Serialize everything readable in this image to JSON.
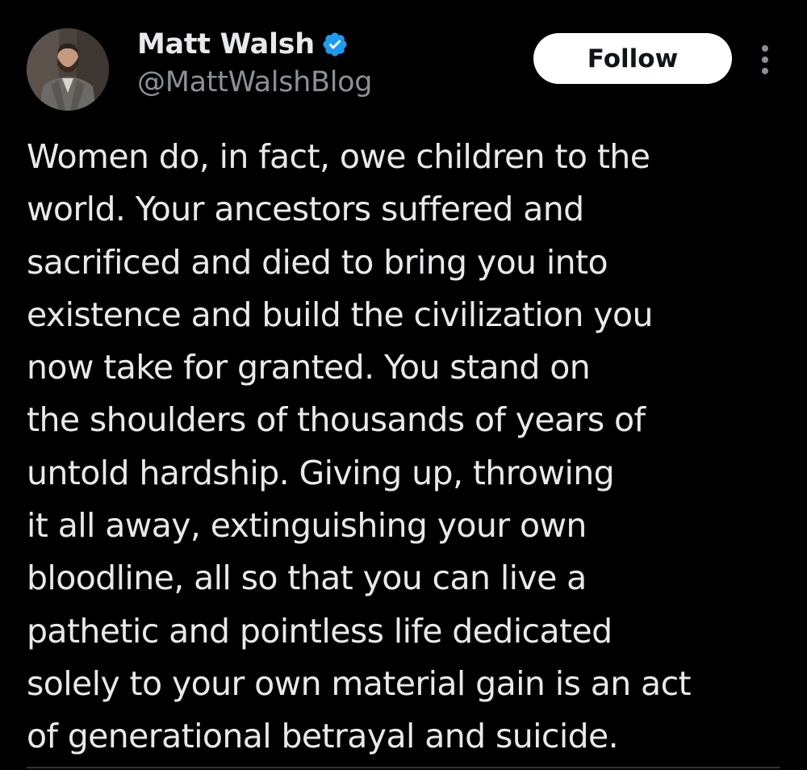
{
  "author": {
    "display_name": "Matt Walsh",
    "handle": "@MattWalshBlog",
    "verified": true,
    "avatar_icon": "profile-photo"
  },
  "actions": {
    "follow_label": "Follow",
    "more_icon": "more-vertical-icon"
  },
  "tweet": {
    "lines": [
      "Women do, in fact, owe children to the",
      "world. Your ancestors suffered and",
      "sacrificed and died to bring you into",
      "existence and build the civilization you",
      "now take for granted. You stand on",
      "the shoulders of thousands of years of",
      "untold hardship. Giving up, throwing",
      "it all away, extinguishing your own",
      "bloodline, all so that you can live a",
      "pathetic and pointless life dedicated",
      "solely to your own material gain is an act",
      "of generational betrayal and suicide."
    ]
  },
  "colors": {
    "background": "#000000",
    "text_primary": "#e7e9ea",
    "text_secondary": "#8b9097",
    "verified_blue": "#1d9bf0",
    "button_bg": "#ffffff",
    "button_text": "#0f1419"
  }
}
